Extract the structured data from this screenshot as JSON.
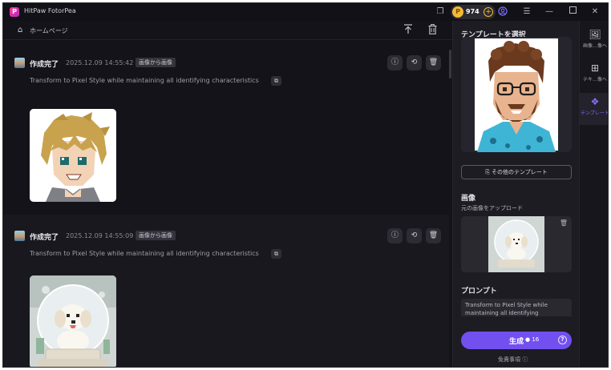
{
  "app": {
    "title": "HitPaw FotorPea",
    "logo": "P"
  },
  "titlebar": {
    "credits": "974",
    "icons": [
      "sticker-icon",
      "coin-icon",
      "plus-icon",
      "user-icon",
      "menu-icon",
      "minimize-icon",
      "maximize-icon",
      "close-icon"
    ]
  },
  "breadcrumb": {
    "home": "ホームページ"
  },
  "entries": [
    {
      "status": "作成完了",
      "time": "2025.12.09  14:55:42",
      "badge": "画像から画像",
      "prompt": "Transform to Pixel Style while maintaining all identifying characteristics"
    },
    {
      "status": "作成完了",
      "time": "2025.12.09  14:55:09",
      "badge": "画像から画像",
      "prompt": "Transform to Pixel Style while maintaining all identifying characteristics"
    }
  ],
  "right_panel": {
    "template_title": "テンプレートを選択",
    "other_templates": "その他のテンプレート",
    "image_title": "画像",
    "upload_label": "元の画像をアップロード",
    "prompt_title": "プロンプト",
    "prompt_text": "Transform to Pixel Style while maintaining all identifying",
    "generate": "生成",
    "cost": "16",
    "disclaimer": "免責事項"
  },
  "side_nav": [
    {
      "label": "画像…像へ",
      "icon": "image-icon"
    },
    {
      "label": "テキ…像へ",
      "icon": "text-image-icon"
    },
    {
      "label": "テンプレート",
      "icon": "template-icon",
      "active": true
    }
  ],
  "colors": {
    "accent": "#7250f0",
    "coin": "#f5b93a",
    "background": "#16151c"
  }
}
